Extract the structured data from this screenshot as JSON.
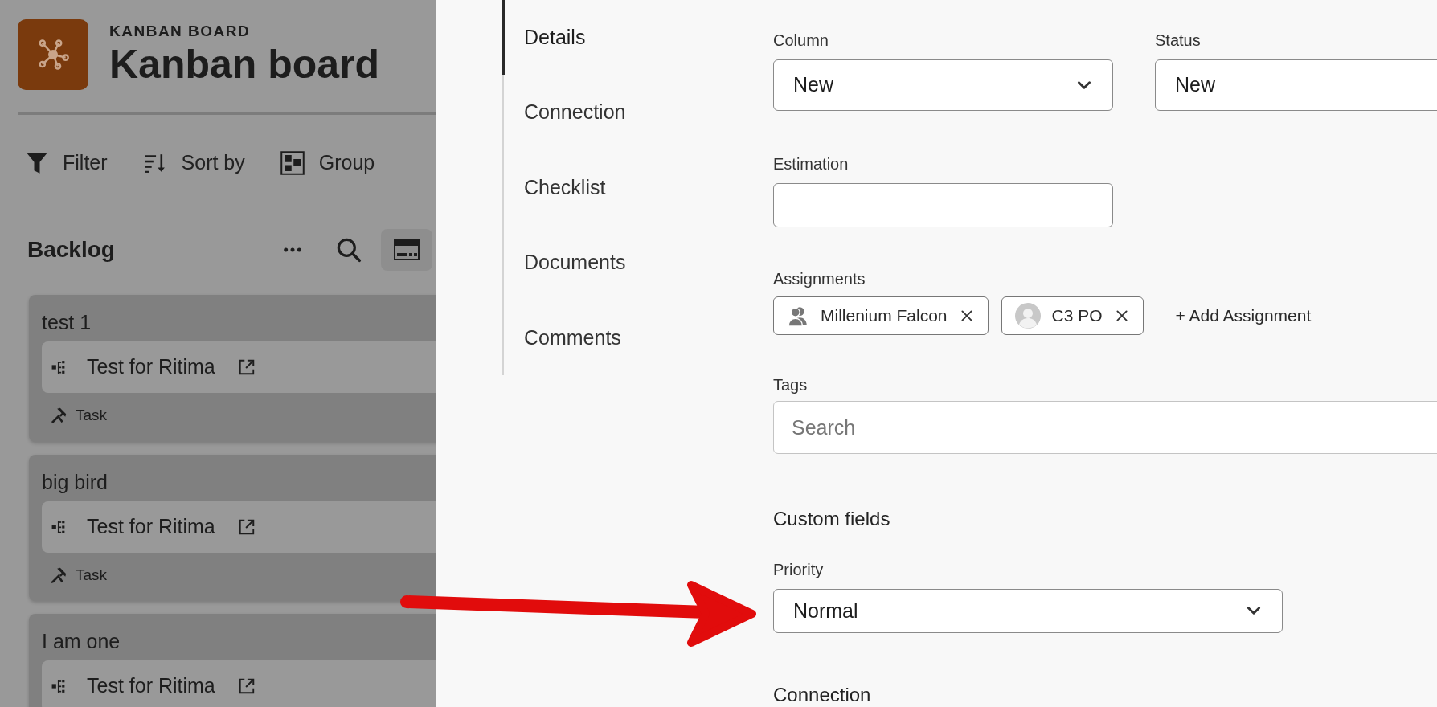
{
  "board": {
    "eyebrow": "KANBAN BOARD",
    "title": "Kanban board"
  },
  "toolbar": [
    {
      "kind": "filter",
      "label": "Filter"
    },
    {
      "kind": "sort",
      "label": "Sort by"
    },
    {
      "kind": "group",
      "label": "Group"
    }
  ],
  "column": {
    "title": "Backlog"
  },
  "cards": [
    {
      "title": "test 1",
      "link": "Test for Ritima",
      "type": "Task"
    },
    {
      "title": "big bird",
      "link": "Test for Ritima",
      "type": "Task"
    },
    {
      "title": "I am one",
      "link": "Test for Ritima"
    }
  ],
  "drawer": {
    "tabs": [
      {
        "label": "Details",
        "selected": true
      },
      {
        "label": "Connection",
        "selected": false
      },
      {
        "label": "Checklist",
        "selected": false
      },
      {
        "label": "Documents",
        "selected": false
      },
      {
        "label": "Comments",
        "selected": false
      }
    ],
    "column_field": {
      "label": "Column",
      "value": "New"
    },
    "status_field": {
      "label": "Status",
      "value": "New"
    },
    "estimation_field": {
      "label": "Estimation"
    },
    "assignments": {
      "label": "Assignments",
      "people": [
        {
          "name": "Millenium Falcon",
          "kind": "group"
        },
        {
          "name": "C3 PO",
          "kind": "user"
        }
      ],
      "add_label": "+ Add Assignment"
    },
    "tags": {
      "label": "Tags",
      "placeholder": "Search"
    },
    "custom_fields": {
      "heading": "Custom fields",
      "priority": {
        "label": "Priority",
        "value": "Normal"
      }
    },
    "next_heading": "Connection"
  }
}
